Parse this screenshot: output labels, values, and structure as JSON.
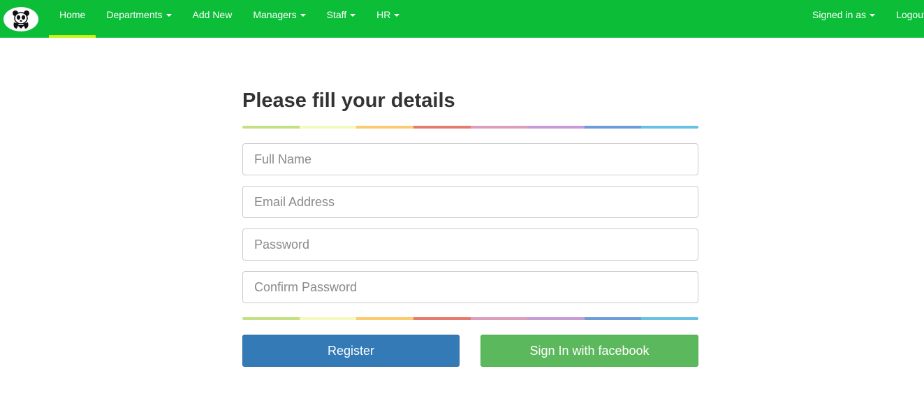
{
  "nav": {
    "logo_icon": "panda-logo-icon",
    "items": [
      {
        "label": "Home",
        "dropdown": false,
        "active": true
      },
      {
        "label": "Departments",
        "dropdown": true,
        "active": false
      },
      {
        "label": "Add New",
        "dropdown": false,
        "active": false
      },
      {
        "label": "Managers",
        "dropdown": true,
        "active": false
      },
      {
        "label": "Staff",
        "dropdown": true,
        "active": false
      },
      {
        "label": "HR",
        "dropdown": true,
        "active": false
      }
    ],
    "right_items": [
      {
        "label": "Signed in as",
        "dropdown": true
      },
      {
        "label": "Logout",
        "dropdown": false
      }
    ],
    "colors": {
      "background": "#0bbd37",
      "active_indicator": "#c6f312"
    }
  },
  "form": {
    "title": "Please fill your details",
    "fields": {
      "full_name": {
        "placeholder": "Full Name",
        "value": ""
      },
      "email": {
        "placeholder": "Email Address",
        "value": ""
      },
      "password": {
        "placeholder": "Password",
        "value": ""
      },
      "confirm_password": {
        "placeholder": "Confirm Password",
        "value": ""
      }
    },
    "buttons": {
      "register": "Register",
      "facebook": "Sign In with facebook"
    },
    "rainbow_colors": [
      "#c2e281",
      "#f3f9bf",
      "#fbcb6d",
      "#e67a6f",
      "#dc9ebd",
      "#c79ad8",
      "#6e9bd9",
      "#66c1e2"
    ],
    "button_colors": {
      "register": "#337ab7",
      "facebook": "#5cb85c"
    }
  }
}
